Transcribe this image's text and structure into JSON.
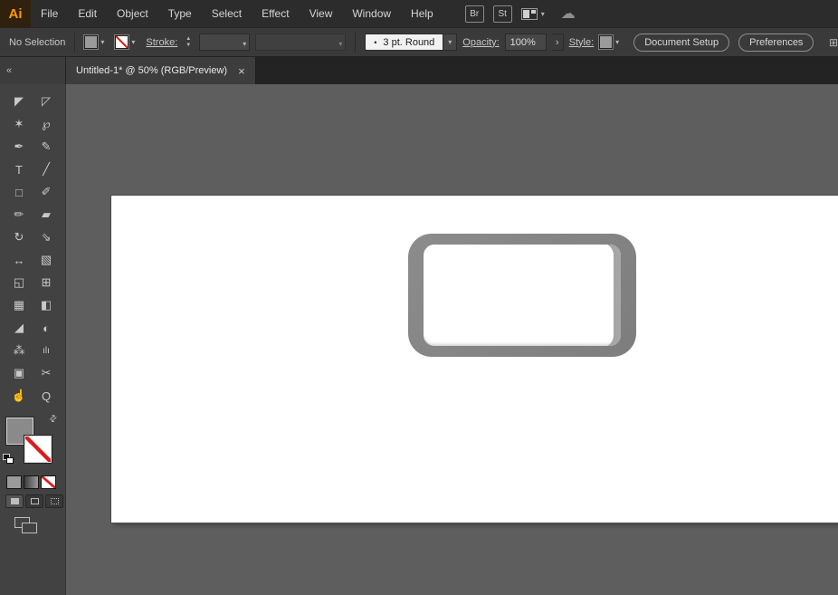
{
  "colors": {
    "logo_orange": "#ff9a00",
    "logo_bg": "#30210e",
    "none_slash_red": "#d21f1f",
    "key_gray": "#828282",
    "toolbar_bg": "#424242",
    "canvas_bg": "#5e5e5e"
  },
  "icons": {
    "caret_down": "▾",
    "stepper_up": "▲",
    "stepper_down": "▼",
    "chevron_right": "›",
    "swap": "⇄",
    "cloud": "☁",
    "dot": "•",
    "panel": "⊞"
  },
  "menubar": {
    "logo_text": "Ai",
    "items": [
      "File",
      "Edit",
      "Object",
      "Type",
      "Select",
      "Effect",
      "View",
      "Window",
      "Help"
    ],
    "br_icon": "Br",
    "st_icon": "St"
  },
  "controlbar": {
    "selection_status": "No Selection",
    "stroke_label": "Stroke:",
    "profile_value": "3 pt. Round",
    "opacity_label": "Opacity:",
    "opacity_value": "100%",
    "style_label": "Style:",
    "document_setup_button": "Document Setup",
    "preferences_button": "Preferences"
  },
  "tabbar": {
    "collapse_icon": "«",
    "title": "Untitled-1* @ 50% (RGB/Preview)",
    "close_icon": "×"
  },
  "toolbar": {
    "tools": [
      {
        "name": "selection-tool",
        "glyph": "◤"
      },
      {
        "name": "direct-selection-tool",
        "glyph": "◸"
      },
      {
        "name": "magic-wand-tool",
        "glyph": "✶"
      },
      {
        "name": "lasso-tool",
        "glyph": "℘"
      },
      {
        "name": "pen-tool",
        "glyph": "✒"
      },
      {
        "name": "curvature-tool",
        "glyph": "✎"
      },
      {
        "name": "type-tool",
        "glyph": "T"
      },
      {
        "name": "line-segment-tool",
        "glyph": "╱"
      },
      {
        "name": "rectangle-tool",
        "glyph": "□"
      },
      {
        "name": "paintbrush-tool",
        "glyph": "✐"
      },
      {
        "name": "pencil-tool",
        "glyph": "✏"
      },
      {
        "name": "eraser-tool",
        "glyph": "▰"
      },
      {
        "name": "rotate-tool",
        "glyph": "↻"
      },
      {
        "name": "scale-tool",
        "glyph": "⇘"
      },
      {
        "name": "width-tool",
        "glyph": "↔"
      },
      {
        "name": "free-transform-tool",
        "glyph": "▧"
      },
      {
        "name": "shape-builder-tool",
        "glyph": "◱"
      },
      {
        "name": "perspective-grid-tool",
        "glyph": "⊞"
      },
      {
        "name": "mesh-tool",
        "glyph": "▦"
      },
      {
        "name": "gradient-tool",
        "glyph": "◧"
      },
      {
        "name": "eyedropper-tool",
        "glyph": "◢"
      },
      {
        "name": "blend-tool",
        "glyph": "◐"
      },
      {
        "name": "symbol-sprayer-tool",
        "glyph": "⁂"
      },
      {
        "name": "column-graph-tool",
        "glyph": "ılı"
      },
      {
        "name": "artboard-tool",
        "glyph": "▣"
      },
      {
        "name": "slice-tool",
        "glyph": "✂"
      },
      {
        "name": "hand-tool",
        "glyph": "☝"
      },
      {
        "name": "zoom-tool",
        "glyph": "Q"
      }
    ]
  }
}
